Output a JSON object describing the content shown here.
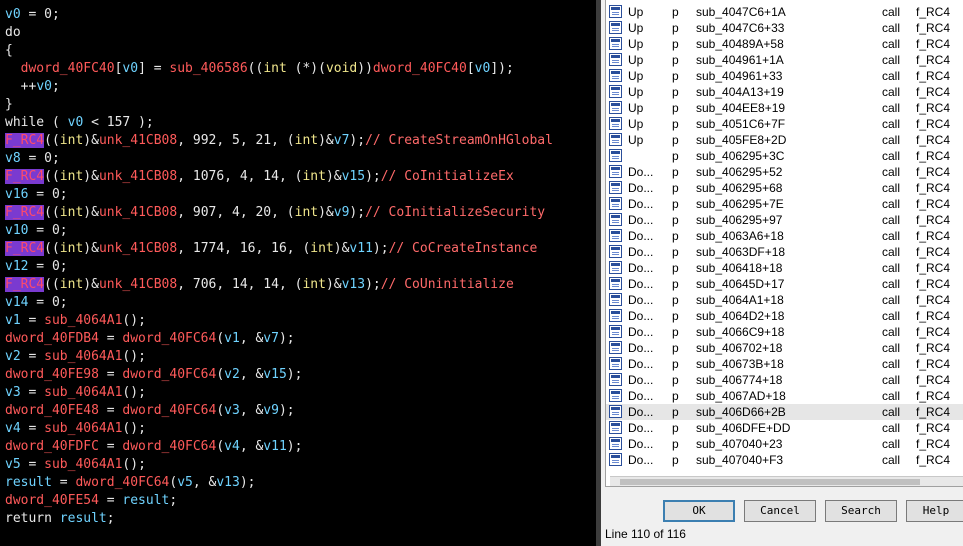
{
  "code": {
    "lines": [
      [
        {
          "t": "v0",
          "s": "var"
        },
        {
          "t": " = 0;",
          "s": "text"
        }
      ],
      [
        {
          "t": "do",
          "s": "text"
        }
      ],
      [
        {
          "t": "{",
          "s": "text"
        }
      ],
      [
        {
          "t": "  ",
          "s": "text"
        },
        {
          "t": "dword_40FC40",
          "s": "glob"
        },
        {
          "t": "[",
          "s": "text"
        },
        {
          "t": "v0",
          "s": "var"
        },
        {
          "t": "] = ",
          "s": "text"
        },
        {
          "t": "sub_406586",
          "s": "glob"
        },
        {
          "t": "((",
          "s": "text"
        },
        {
          "t": "int",
          "s": "kw"
        },
        {
          "t": " (*)(",
          "s": "text"
        },
        {
          "t": "void",
          "s": "kw"
        },
        {
          "t": "))",
          "s": "text"
        },
        {
          "t": "dword_40FC40",
          "s": "glob"
        },
        {
          "t": "[",
          "s": "text"
        },
        {
          "t": "v0",
          "s": "var"
        },
        {
          "t": "]);",
          "s": "text"
        }
      ],
      [
        {
          "t": "  ++",
          "s": "text"
        },
        {
          "t": "v0",
          "s": "var"
        },
        {
          "t": ";",
          "s": "text"
        }
      ],
      [
        {
          "t": "}",
          "s": "text"
        }
      ],
      [
        {
          "t": "while ( ",
          "s": "text"
        },
        {
          "t": "v0",
          "s": "var"
        },
        {
          "t": " < 157 );",
          "s": "text"
        }
      ],
      [
        {
          "t": "F_RC4",
          "s": "hl"
        },
        {
          "t": "((",
          "s": "text"
        },
        {
          "t": "int",
          "s": "kw"
        },
        {
          "t": ")&",
          "s": "text"
        },
        {
          "t": "unk_41CB08",
          "s": "glob"
        },
        {
          "t": ", 992, 5, 21, (",
          "s": "text"
        },
        {
          "t": "int",
          "s": "kw"
        },
        {
          "t": ")&",
          "s": "text"
        },
        {
          "t": "v7",
          "s": "var"
        },
        {
          "t": ");",
          "s": "text"
        },
        {
          "t": "// CreateStreamOnHGlobal",
          "s": "cm"
        }
      ],
      [
        {
          "t": "v8",
          "s": "var"
        },
        {
          "t": " = 0;",
          "s": "text"
        }
      ],
      [
        {
          "t": "F_RC4",
          "s": "hl"
        },
        {
          "t": "((",
          "s": "text"
        },
        {
          "t": "int",
          "s": "kw"
        },
        {
          "t": ")&",
          "s": "text"
        },
        {
          "t": "unk_41CB08",
          "s": "glob"
        },
        {
          "t": ", 1076, 4, 14, (",
          "s": "text"
        },
        {
          "t": "int",
          "s": "kw"
        },
        {
          "t": ")&",
          "s": "text"
        },
        {
          "t": "v15",
          "s": "var"
        },
        {
          "t": ");",
          "s": "text"
        },
        {
          "t": "// CoInitializeEx",
          "s": "cm"
        }
      ],
      [
        {
          "t": "v16",
          "s": "var"
        },
        {
          "t": " = 0;",
          "s": "text"
        }
      ],
      [
        {
          "t": "F_RC4",
          "s": "hl"
        },
        {
          "t": "((",
          "s": "text"
        },
        {
          "t": "int",
          "s": "kw"
        },
        {
          "t": ")&",
          "s": "text"
        },
        {
          "t": "unk_41CB08",
          "s": "glob"
        },
        {
          "t": ", 907, 4, 20, (",
          "s": "text"
        },
        {
          "t": "int",
          "s": "kw"
        },
        {
          "t": ")&",
          "s": "text"
        },
        {
          "t": "v9",
          "s": "var"
        },
        {
          "t": ");",
          "s": "text"
        },
        {
          "t": "// CoInitializeSecurity",
          "s": "cm"
        }
      ],
      [
        {
          "t": "v10",
          "s": "var"
        },
        {
          "t": " = 0;",
          "s": "text"
        }
      ],
      [
        {
          "t": "F_RC4",
          "s": "hl"
        },
        {
          "t": "((",
          "s": "text"
        },
        {
          "t": "int",
          "s": "kw"
        },
        {
          "t": ")&",
          "s": "text"
        },
        {
          "t": "unk_41CB08",
          "s": "glob"
        },
        {
          "t": ", 1774, 16, 16, (",
          "s": "text"
        },
        {
          "t": "int",
          "s": "kw"
        },
        {
          "t": ")&",
          "s": "text"
        },
        {
          "t": "v11",
          "s": "var"
        },
        {
          "t": ");",
          "s": "text"
        },
        {
          "t": "// CoCreateInstance",
          "s": "cm"
        }
      ],
      [
        {
          "t": "v12",
          "s": "var"
        },
        {
          "t": " = 0;",
          "s": "text"
        }
      ],
      [
        {
          "t": "F_RC4",
          "s": "hl"
        },
        {
          "t": "((",
          "s": "text"
        },
        {
          "t": "int",
          "s": "kw"
        },
        {
          "t": ")&",
          "s": "text"
        },
        {
          "t": "unk_41CB08",
          "s": "glob"
        },
        {
          "t": ", 706, 14, 14, (",
          "s": "text"
        },
        {
          "t": "int",
          "s": "kw"
        },
        {
          "t": ")&",
          "s": "text"
        },
        {
          "t": "v13",
          "s": "var"
        },
        {
          "t": ");",
          "s": "text"
        },
        {
          "t": "// CoUninitialize",
          "s": "cm"
        }
      ],
      [
        {
          "t": "v14",
          "s": "var"
        },
        {
          "t": " = 0;",
          "s": "text"
        }
      ],
      [
        {
          "t": "v1",
          "s": "var"
        },
        {
          "t": " = ",
          "s": "text"
        },
        {
          "t": "sub_4064A1",
          "s": "glob"
        },
        {
          "t": "();",
          "s": "text"
        }
      ],
      [
        {
          "t": "dword_40FDB4",
          "s": "glob"
        },
        {
          "t": " = ",
          "s": "text"
        },
        {
          "t": "dword_40FC64",
          "s": "glob"
        },
        {
          "t": "(",
          "s": "text"
        },
        {
          "t": "v1",
          "s": "var"
        },
        {
          "t": ", &",
          "s": "text"
        },
        {
          "t": "v7",
          "s": "var"
        },
        {
          "t": ");",
          "s": "text"
        }
      ],
      [
        {
          "t": "v2",
          "s": "var"
        },
        {
          "t": " = ",
          "s": "text"
        },
        {
          "t": "sub_4064A1",
          "s": "glob"
        },
        {
          "t": "();",
          "s": "text"
        }
      ],
      [
        {
          "t": "dword_40FE98",
          "s": "glob"
        },
        {
          "t": " = ",
          "s": "text"
        },
        {
          "t": "dword_40FC64",
          "s": "glob"
        },
        {
          "t": "(",
          "s": "text"
        },
        {
          "t": "v2",
          "s": "var"
        },
        {
          "t": ", &",
          "s": "text"
        },
        {
          "t": "v15",
          "s": "var"
        },
        {
          "t": ");",
          "s": "text"
        }
      ],
      [
        {
          "t": "v3",
          "s": "var"
        },
        {
          "t": " = ",
          "s": "text"
        },
        {
          "t": "sub_4064A1",
          "s": "glob"
        },
        {
          "t": "();",
          "s": "text"
        }
      ],
      [
        {
          "t": "dword_40FE48",
          "s": "glob"
        },
        {
          "t": " = ",
          "s": "text"
        },
        {
          "t": "dword_40FC64",
          "s": "glob"
        },
        {
          "t": "(",
          "s": "text"
        },
        {
          "t": "v3",
          "s": "var"
        },
        {
          "t": ", &",
          "s": "text"
        },
        {
          "t": "v9",
          "s": "var"
        },
        {
          "t": ");",
          "s": "text"
        }
      ],
      [
        {
          "t": "v4",
          "s": "var"
        },
        {
          "t": " = ",
          "s": "text"
        },
        {
          "t": "sub_4064A1",
          "s": "glob"
        },
        {
          "t": "();",
          "s": "text"
        }
      ],
      [
        {
          "t": "dword_40FDFC",
          "s": "glob"
        },
        {
          "t": " = ",
          "s": "text"
        },
        {
          "t": "dword_40FC64",
          "s": "glob"
        },
        {
          "t": "(",
          "s": "text"
        },
        {
          "t": "v4",
          "s": "var"
        },
        {
          "t": ", &",
          "s": "text"
        },
        {
          "t": "v11",
          "s": "var"
        },
        {
          "t": ");",
          "s": "text"
        }
      ],
      [
        {
          "t": "v5",
          "s": "var"
        },
        {
          "t": " = ",
          "s": "text"
        },
        {
          "t": "sub_4064A1",
          "s": "glob"
        },
        {
          "t": "();",
          "s": "text"
        }
      ],
      [
        {
          "t": "result",
          "s": "var"
        },
        {
          "t": " = ",
          "s": "text"
        },
        {
          "t": "dword_40FC64",
          "s": "glob"
        },
        {
          "t": "(",
          "s": "text"
        },
        {
          "t": "v5",
          "s": "var"
        },
        {
          "t": ", &",
          "s": "text"
        },
        {
          "t": "v13",
          "s": "var"
        },
        {
          "t": ");",
          "s": "text"
        }
      ],
      [
        {
          "t": "dword_40FE54",
          "s": "glob"
        },
        {
          "t": " = ",
          "s": "text"
        },
        {
          "t": "result",
          "s": "var"
        },
        {
          "t": ";",
          "s": "text"
        }
      ],
      [
        {
          "t": "return ",
          "s": "text"
        },
        {
          "t": "result",
          "s": "var"
        },
        {
          "t": ";",
          "s": "text"
        }
      ]
    ]
  },
  "xrefs": {
    "rows": [
      {
        "dir": "Up",
        "type": "p",
        "address": "sub_4047C6+1A",
        "instruction": "call",
        "function": "f_RC4"
      },
      {
        "dir": "Up",
        "type": "p",
        "address": "sub_4047C6+33",
        "instruction": "call",
        "function": "f_RC4"
      },
      {
        "dir": "Up",
        "type": "p",
        "address": "sub_40489A+58",
        "instruction": "call",
        "function": "f_RC4"
      },
      {
        "dir": "Up",
        "type": "p",
        "address": "sub_404961+1A",
        "instruction": "call",
        "function": "f_RC4"
      },
      {
        "dir": "Up",
        "type": "p",
        "address": "sub_404961+33",
        "instruction": "call",
        "function": "f_RC4"
      },
      {
        "dir": "Up",
        "type": "p",
        "address": "sub_404A13+19",
        "instruction": "call",
        "function": "f_RC4"
      },
      {
        "dir": "Up",
        "type": "p",
        "address": "sub_404EE8+19",
        "instruction": "call",
        "function": "f_RC4"
      },
      {
        "dir": "Up",
        "type": "p",
        "address": "sub_4051C6+7F",
        "instruction": "call",
        "function": "f_RC4"
      },
      {
        "dir": "Up",
        "type": "p",
        "address": "sub_405FE8+2D",
        "instruction": "call",
        "function": "f_RC4"
      },
      {
        "dir": "",
        "type": "p",
        "address": "sub_406295+3C",
        "instruction": "call",
        "function": "f_RC4"
      },
      {
        "dir": "Do...",
        "type": "p",
        "address": "sub_406295+52",
        "instruction": "call",
        "function": "f_RC4"
      },
      {
        "dir": "Do...",
        "type": "p",
        "address": "sub_406295+68",
        "instruction": "call",
        "function": "f_RC4"
      },
      {
        "dir": "Do...",
        "type": "p",
        "address": "sub_406295+7E",
        "instruction": "call",
        "function": "f_RC4"
      },
      {
        "dir": "Do...",
        "type": "p",
        "address": "sub_406295+97",
        "instruction": "call",
        "function": "f_RC4"
      },
      {
        "dir": "Do...",
        "type": "p",
        "address": "sub_4063A6+18",
        "instruction": "call",
        "function": "f_RC4"
      },
      {
        "dir": "Do...",
        "type": "p",
        "address": "sub_4063DF+18",
        "instruction": "call",
        "function": "f_RC4"
      },
      {
        "dir": "Do...",
        "type": "p",
        "address": "sub_406418+18",
        "instruction": "call",
        "function": "f_RC4"
      },
      {
        "dir": "Do...",
        "type": "p",
        "address": "sub_40645D+17",
        "instruction": "call",
        "function": "f_RC4"
      },
      {
        "dir": "Do...",
        "type": "p",
        "address": "sub_4064A1+18",
        "instruction": "call",
        "function": "f_RC4"
      },
      {
        "dir": "Do...",
        "type": "p",
        "address": "sub_4064D2+18",
        "instruction": "call",
        "function": "f_RC4"
      },
      {
        "dir": "Do...",
        "type": "p",
        "address": "sub_4066C9+18",
        "instruction": "call",
        "function": "f_RC4"
      },
      {
        "dir": "Do...",
        "type": "p",
        "address": "sub_406702+18",
        "instruction": "call",
        "function": "f_RC4"
      },
      {
        "dir": "Do...",
        "type": "p",
        "address": "sub_40673B+18",
        "instruction": "call",
        "function": "f_RC4"
      },
      {
        "dir": "Do...",
        "type": "p",
        "address": "sub_406774+18",
        "instruction": "call",
        "function": "f_RC4"
      },
      {
        "dir": "Do...",
        "type": "p",
        "address": "sub_4067AD+18",
        "instruction": "call",
        "function": "f_RC4"
      },
      {
        "dir": "Do...",
        "type": "p",
        "address": "sub_406D66+2B",
        "instruction": "call",
        "function": "f_RC4",
        "selected": true
      },
      {
        "dir": "Do...",
        "type": "p",
        "address": "sub_406DFE+DD",
        "instruction": "call",
        "function": "f_RC4"
      },
      {
        "dir": "Do...",
        "type": "p",
        "address": "sub_407040+23",
        "instruction": "call",
        "function": "f_RC4"
      },
      {
        "dir": "Do...",
        "type": "p",
        "address": "sub_407040+F3",
        "instruction": "call",
        "function": "f_RC4"
      }
    ]
  },
  "buttons": {
    "ok": "OK",
    "cancel": "Cancel",
    "search": "Search",
    "help": "Help"
  },
  "status": "Line 110 of 116"
}
